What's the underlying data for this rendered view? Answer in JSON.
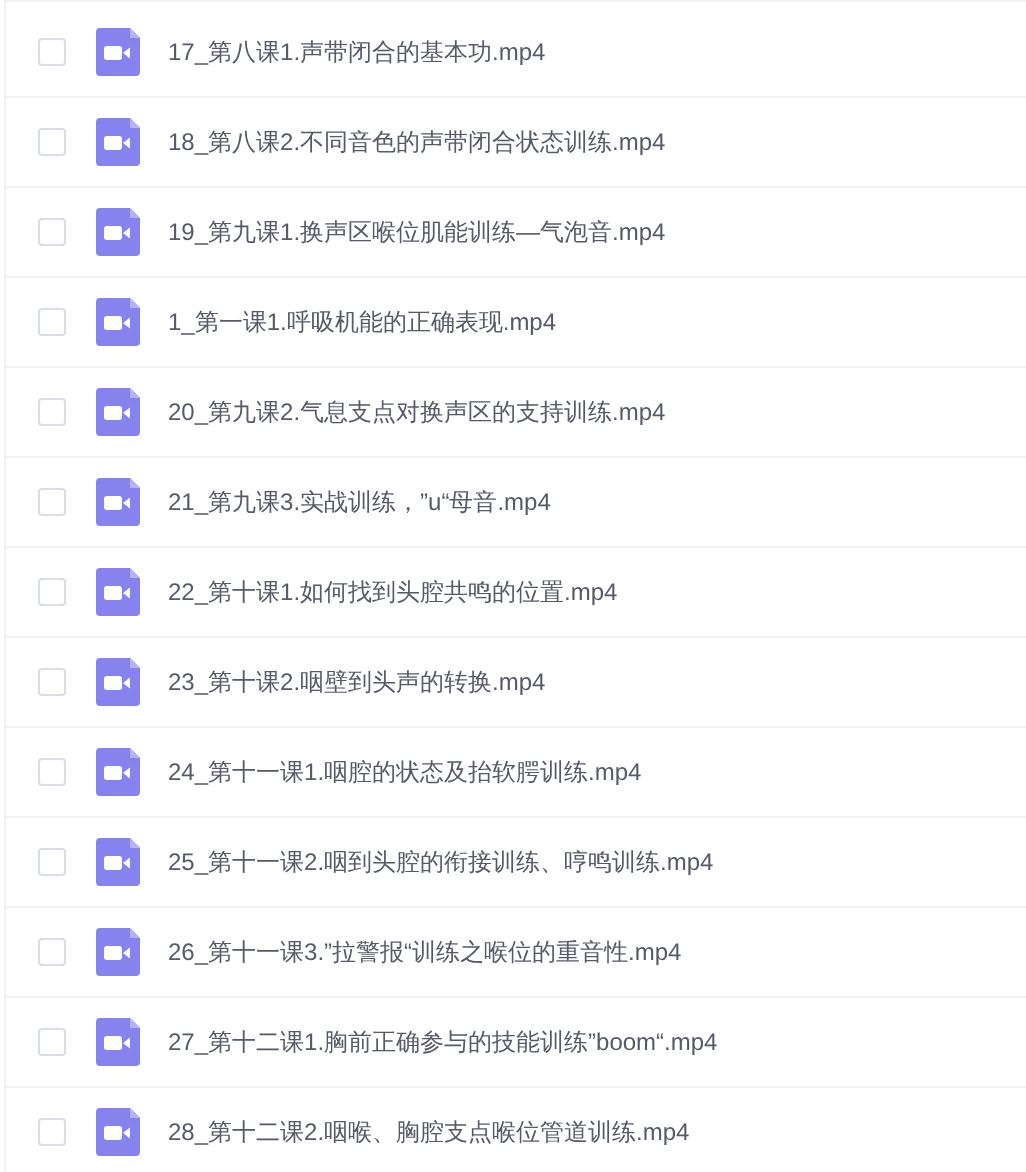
{
  "files": [
    {
      "name": "17_第八课1.声带闭合的基本功.mp4",
      "checked": false
    },
    {
      "name": "18_第八课2.不同音色的声带闭合状态训练.mp4",
      "checked": false
    },
    {
      "name": "19_第九课1.换声区喉位肌能训练—气泡音.mp4",
      "checked": false
    },
    {
      "name": "1_第一课1.呼吸机能的正确表现.mp4",
      "checked": false
    },
    {
      "name": "20_第九课2.气息支点对换声区的支持训练.mp4",
      "checked": false
    },
    {
      "name": "21_第九课3.实战训练，”u“母音.mp4",
      "checked": false
    },
    {
      "name": "22_第十课1.如何找到头腔共鸣的位置.mp4",
      "checked": false
    },
    {
      "name": "23_第十课2.咽壁到头声的转换.mp4",
      "checked": false
    },
    {
      "name": "24_第十一课1.咽腔的状态及抬软腭训练.mp4",
      "checked": false
    },
    {
      "name": "25_第十一课2.咽到头腔的衔接训练、哼鸣训练.mp4",
      "checked": false
    },
    {
      "name": "26_第十一课3.”拉警报“训练之喉位的重音性.mp4",
      "checked": false
    },
    {
      "name": "27_第十二课1.胸前正确参与的技能训练”boom“.mp4",
      "checked": false
    },
    {
      "name": "28_第十二课2.咽喉、胸腔支点喉位管道训练.mp4",
      "checked": false
    }
  ]
}
